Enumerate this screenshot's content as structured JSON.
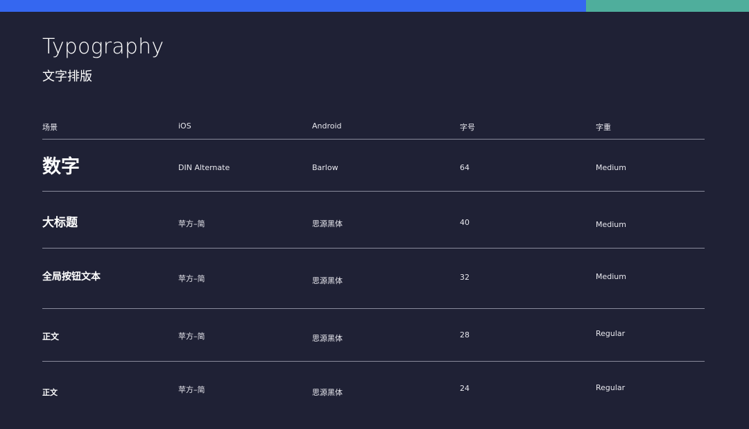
{
  "colors": {
    "background": "#1f2135",
    "accent_blue": "#3567f0",
    "accent_green": "#4fae9c",
    "divider": "#8a8b9c"
  },
  "header": {
    "title": "Typography",
    "subtitle": "文字排版"
  },
  "table": {
    "columns": [
      "场景",
      "iOS",
      "Android",
      "字号",
      "字重"
    ],
    "rows": [
      {
        "scene": "数字",
        "ios": "DIN Alternate",
        "android": "Barlow",
        "size": "64",
        "weight": "Medium"
      },
      {
        "scene": "大标题",
        "ios": "苹方–简",
        "android": "思源黑体",
        "size": "40",
        "weight": "Medium"
      },
      {
        "scene": "全局按钮文本",
        "ios": "苹方–简",
        "android": "思源黑体",
        "size": "32",
        "weight": "Medium"
      },
      {
        "scene": "正文",
        "ios": "苹方–简",
        "android": "思源黑体",
        "size": "28",
        "weight": "Regular"
      },
      {
        "scene": "正文",
        "ios": "苹方–简",
        "android": "思源黑体",
        "size": "24",
        "weight": "Regular"
      }
    ]
  }
}
